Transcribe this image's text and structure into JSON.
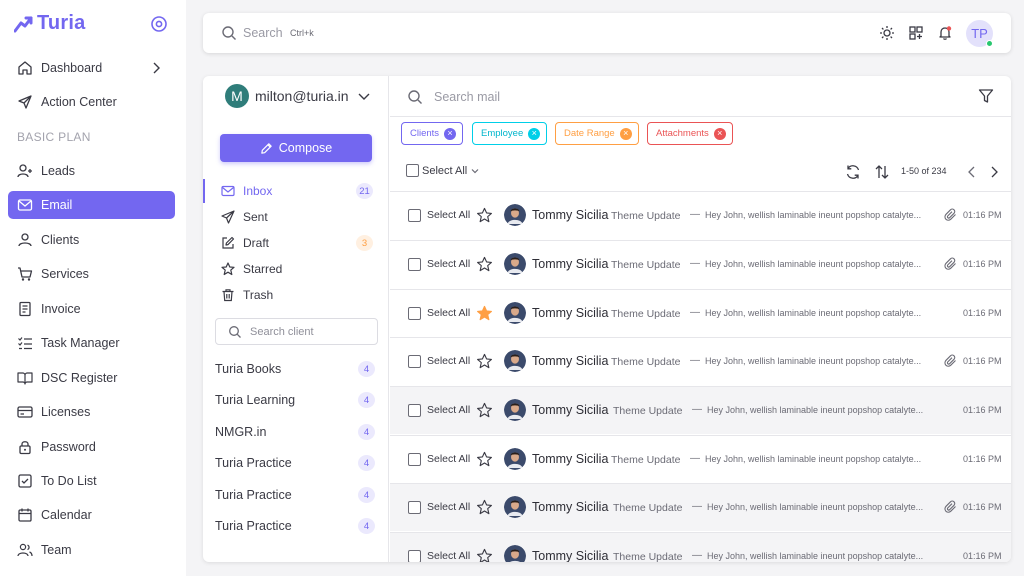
{
  "brand": {
    "name": "Turia",
    "accent": "#7367f0"
  },
  "sidebar": {
    "section_label": "BASIC PLAN",
    "items": [
      {
        "label": "Dashboard",
        "icon": "home-icon"
      },
      {
        "label": "Action Center",
        "icon": "send-icon"
      },
      {
        "label": "Leads",
        "icon": "user-plus-icon"
      },
      {
        "label": "Email",
        "icon": "mail-icon",
        "active": true
      },
      {
        "label": "Clients",
        "icon": "user-icon"
      },
      {
        "label": "Services",
        "icon": "cart-icon"
      },
      {
        "label": "Invoice",
        "icon": "invoice-icon"
      },
      {
        "label": "Task Manager",
        "icon": "checklist-icon"
      },
      {
        "label": "DSC Register",
        "icon": "book-icon"
      },
      {
        "label": "Licenses",
        "icon": "card-icon"
      },
      {
        "label": "Password",
        "icon": "lock-icon"
      },
      {
        "label": "To Do List",
        "icon": "checkbox-icon"
      },
      {
        "label": "Calendar",
        "icon": "calendar-icon"
      },
      {
        "label": "Team",
        "icon": "team-icon"
      }
    ]
  },
  "topbar": {
    "search_placeholder": "Search",
    "shortcut": "Ctrl+k",
    "avatar_initials": "TP"
  },
  "mail": {
    "account": {
      "initial": "M",
      "email": "milton@turia.in"
    },
    "compose_label": "Compose",
    "folders": [
      {
        "label": "Inbox",
        "count": "21",
        "active": true
      },
      {
        "label": "Sent",
        "count": ""
      },
      {
        "label": "Draft",
        "count": "3"
      },
      {
        "label": "Starred",
        "count": ""
      },
      {
        "label": "Trash",
        "count": ""
      }
    ],
    "client_search_placeholder": "Search client",
    "clients": [
      {
        "name": "Turia Books",
        "count": "4"
      },
      {
        "name": "Turia Learning",
        "count": "4"
      },
      {
        "name": "NMGR.in",
        "count": "4"
      },
      {
        "name": "Turia Practice",
        "count": "4"
      },
      {
        "name": "Turia Practice",
        "count": "4"
      },
      {
        "name": "Turia Practice",
        "count": "4"
      }
    ],
    "search_placeholder": "Search mail",
    "filters": [
      "Clients",
      "Employee",
      "Date Range",
      "Attachments"
    ],
    "select_all_label": "Select All",
    "pagination": "1-50 of 234",
    "rows": [
      {
        "select": "Select All",
        "sender": "Tommy Sicilia",
        "subject": "Theme Update",
        "dash": "—",
        "snippet": "Hey John, wellish laminable ineunt popshop catalyte...",
        "time": "01:16 PM",
        "starred": false,
        "attachment": true,
        "read": false
      },
      {
        "select": "Select All",
        "sender": "Tommy Sicilia",
        "subject": "Theme Update",
        "dash": "—",
        "snippet": "Hey John, wellish laminable ineunt popshop catalyte...",
        "time": "01:16 PM",
        "starred": false,
        "attachment": true,
        "read": false
      },
      {
        "select": "Select All",
        "sender": "Tommy Sicilia",
        "subject": "Theme Update",
        "dash": "—",
        "snippet": "Hey John, wellish laminable ineunt popshop catalyte...",
        "time": "01:16 PM",
        "starred": true,
        "attachment": false,
        "read": false
      },
      {
        "select": "Select All",
        "sender": "Tommy Sicilia",
        "subject": "Theme Update",
        "dash": "—",
        "snippet": "Hey John, wellish laminable ineunt popshop catalyte...",
        "time": "01:16 PM",
        "starred": false,
        "attachment": true,
        "read": false
      },
      {
        "select": "Select All",
        "sender": "Tommy Sicilia",
        "subject": "Theme Update",
        "dash": "—",
        "snippet": "Hey John, wellish laminable ineunt popshop catalyte...",
        "time": "01:16 PM",
        "starred": false,
        "attachment": false,
        "read": true
      },
      {
        "select": "Select All",
        "sender": "Tommy Sicilia",
        "subject": "Theme Update",
        "dash": "—",
        "snippet": "Hey John, wellish laminable ineunt popshop catalyte...",
        "time": "01:16 PM",
        "starred": false,
        "attachment": false,
        "read": false
      },
      {
        "select": "Select All",
        "sender": "Tommy Sicilia",
        "subject": "Theme Update",
        "dash": "—",
        "snippet": "Hey John, wellish laminable ineunt popshop catalyte...",
        "time": "01:16 PM",
        "starred": false,
        "attachment": true,
        "read": true
      },
      {
        "select": "Select All",
        "sender": "Tommy Sicilia",
        "subject": "Theme Update",
        "dash": "—",
        "snippet": "Hey John, wellish laminable ineunt popshop catalyte...",
        "time": "01:16 PM",
        "starred": false,
        "attachment": false,
        "read": true
      }
    ]
  }
}
